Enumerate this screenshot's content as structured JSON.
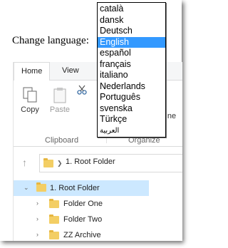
{
  "page": {
    "label": "Change language:"
  },
  "language_dropdown": {
    "options": [
      "català",
      "dansk",
      "Deutsch",
      "English",
      "español",
      "français",
      "italiano",
      "Nederlands",
      "Português",
      "svenska",
      "Türkçe",
      "العربية"
    ],
    "selected": "English"
  },
  "ribbon": {
    "tabs": [
      "Home",
      "View"
    ],
    "copy_label": "Copy",
    "paste_label": "Paste",
    "group_clipboard": "Clipboard",
    "group_organize": "Organize",
    "partial_label": "ne"
  },
  "address_bar": {
    "path": "1. Root Folder"
  },
  "tree": [
    {
      "label": "1. Root Folder",
      "selected": true
    },
    {
      "label": "Folder One",
      "selected": false
    },
    {
      "label": "Folder Two",
      "selected": false
    },
    {
      "label": "ZZ Archive",
      "selected": false
    }
  ],
  "colors": {
    "selection": "#cce8ff",
    "dropdown_highlight": "#3399ff",
    "folder": "#f3ce64"
  }
}
